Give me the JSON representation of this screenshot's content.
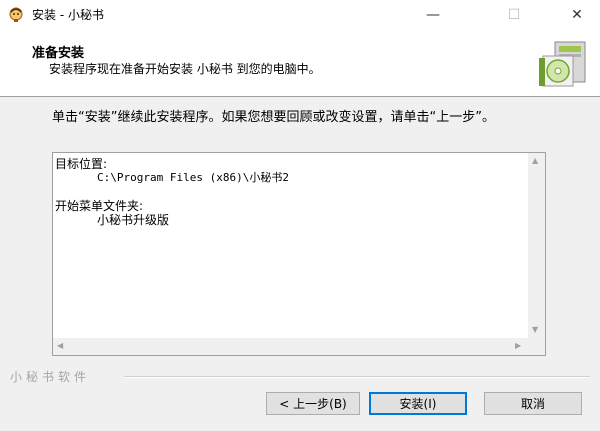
{
  "window": {
    "title": "安装 - 小秘书",
    "minimize_glyph": "—",
    "maximize_glyph": "☐",
    "close_glyph": "✕"
  },
  "header": {
    "title": "准备安装",
    "subtitle": "安装程序现在准备开始安装 小秘书 到您的电脑中。"
  },
  "instruction": "单击“安装”继续此安装程序。如果您想要回顾或改变设置，请单击“上一步”。",
  "info_box": {
    "dest_label": "目标位置:",
    "dest_value": "C:\\Program Files (x86)\\小秘书2",
    "menu_label": "开始菜单文件夹:",
    "menu_value": "小秘书升级版"
  },
  "brand": "小秘书软件",
  "buttons": {
    "back": "< 上一步(B)",
    "install": "安装(I)",
    "cancel": "取消"
  }
}
